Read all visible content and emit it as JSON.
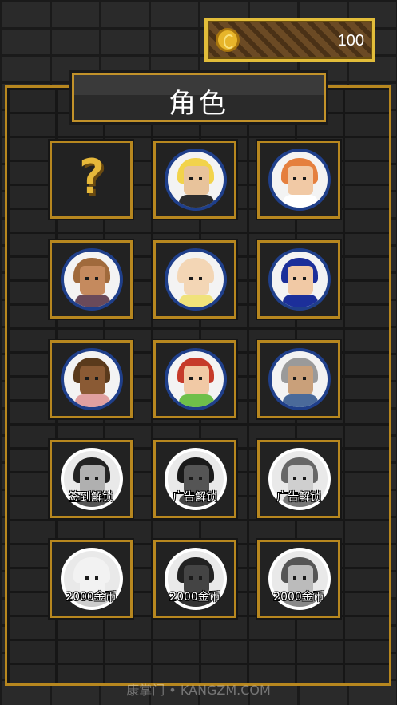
{
  "header": {
    "coin_icon": "gold-coin-icon",
    "coin_count": "100"
  },
  "panel": {
    "title": "角色"
  },
  "characters": [
    {
      "slot": "mystery",
      "label": "",
      "icon": "question-mark-icon",
      "skin": "",
      "hair": "",
      "shirt": ""
    },
    {
      "slot": "blonde",
      "label": "",
      "icon": "",
      "skin": "#e8c39b",
      "hair": "#f2d34b",
      "shirt": "#2d2d2d"
    },
    {
      "slot": "redhead",
      "label": "",
      "icon": "",
      "skin": "#f1c9a5",
      "hair": "#e57f3d",
      "shirt": "#ffffff"
    },
    {
      "slot": "curly-brown",
      "label": "",
      "icon": "",
      "skin": "#c58a5e",
      "hair": "#a06a3c",
      "shirt": "#6a4a5a"
    },
    {
      "slot": "bald",
      "label": "",
      "icon": "",
      "skin": "#f3d6b5",
      "hair": "#f3d6b5",
      "shirt": "#f0e27a"
    },
    {
      "slot": "blue-hood",
      "label": "",
      "icon": "",
      "skin": "#f1c9a5",
      "hair": "#1c2f9a",
      "shirt": "#1c2f9a"
    },
    {
      "slot": "afro",
      "label": "",
      "icon": "",
      "skin": "#8a5a34",
      "hair": "#5a3a1c",
      "shirt": "#e0a0a0"
    },
    {
      "slot": "red-cap",
      "label": "",
      "icon": "",
      "skin": "#f1c9a5",
      "hair": "#c63a2a",
      "shirt": "#6fbf4a"
    },
    {
      "slot": "grey-hair",
      "label": "",
      "icon": "",
      "skin": "#c9a07a",
      "hair": "#9a9a9a",
      "shirt": "#4a6a9a"
    },
    {
      "slot": "locked-1",
      "label": "签到解锁",
      "icon": "",
      "skin": "#b0b0b0",
      "hair": "#222222",
      "shirt": "#555555"
    },
    {
      "slot": "locked-2",
      "label": "广告解锁",
      "icon": "",
      "skin": "#555555",
      "hair": "#1a1a1a",
      "shirt": "#444444"
    },
    {
      "slot": "locked-3",
      "label": "广告解锁",
      "icon": "",
      "skin": "#cfcfcf",
      "hair": "#666666",
      "shirt": "#777777"
    },
    {
      "slot": "locked-4",
      "label": "2000金币",
      "icon": "",
      "skin": "#f2f2f2",
      "hair": "#f2f2f2",
      "shirt": "#cccccc"
    },
    {
      "slot": "locked-5",
      "label": "2000金币",
      "icon": "",
      "skin": "#444444",
      "hair": "#222222",
      "shirt": "#333333"
    },
    {
      "slot": "locked-6",
      "label": "2000金币",
      "icon": "",
      "skin": "#bbbbbb",
      "hair": "#555555",
      "shirt": "#888888"
    }
  ],
  "watermark": "康掌门 • KANGZM.COM"
}
